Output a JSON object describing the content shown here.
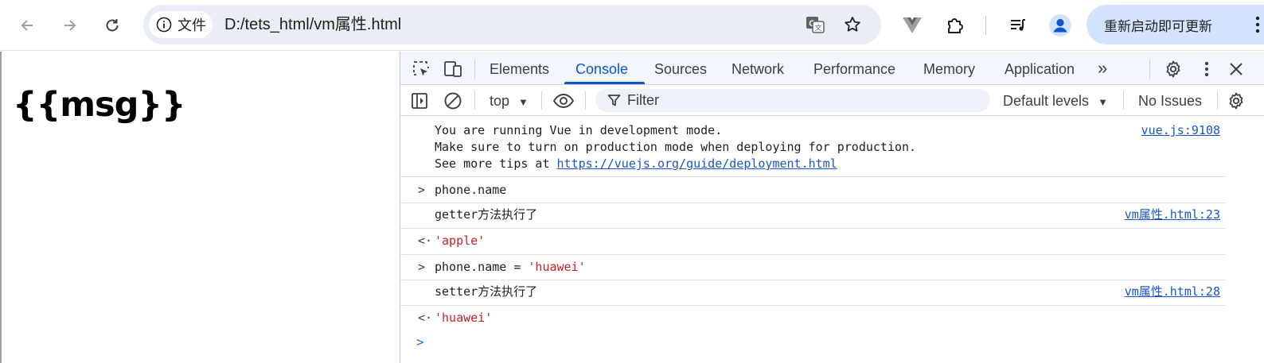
{
  "browser": {
    "nav": {
      "back_icon": "back-arrow-icon",
      "forward_icon": "forward-arrow-icon",
      "reload_icon": "reload-icon"
    },
    "omnibox": {
      "site_info_label": "文件",
      "url": "D:/tets_html/vm属性.html",
      "translate_icon": "translate-icon",
      "bookmark_icon": "star-icon"
    },
    "extensions": [
      "vue-devtools-icon",
      "puzzle-extensions-icon",
      "media-queue-icon",
      "profile-avatar-icon"
    ],
    "update_button_label": "重新启动即可更新"
  },
  "page": {
    "heading": "{{msg}}"
  },
  "devtools": {
    "tabs": [
      {
        "label": "Elements",
        "active": false
      },
      {
        "label": "Console",
        "active": true
      },
      {
        "label": "Sources",
        "active": false
      },
      {
        "label": "Network",
        "active": false
      },
      {
        "label": "Performance",
        "active": false
      },
      {
        "label": "Memory",
        "active": false
      },
      {
        "label": "Application",
        "active": false
      }
    ],
    "more_tabs": "»",
    "filterbar": {
      "context": "top",
      "filter_placeholder": "Filter",
      "levels": "Default levels",
      "issues": "No Issues"
    },
    "console": {
      "vue_notice": {
        "line1": "You are running Vue in development mode.",
        "line2": "Make sure to turn on production mode when deploying for production.",
        "line3_prefix": "See more tips at ",
        "line3_link": "https://vuejs.org/guide/deployment.html",
        "source": "vue.js:9108"
      },
      "input1": "phone.name",
      "log1": {
        "text": "getter方法执行了",
        "source": "vm属性.html:23"
      },
      "result1": "'apple'",
      "input2_prefix": "phone.name = ",
      "input2_string": "'huawei'",
      "log2": {
        "text": "setter方法执行了",
        "source": "vm属性.html:28"
      },
      "result2": "'huawei'",
      "input_marker": ">",
      "result_marker": "<·",
      "prompt": ">"
    }
  },
  "colors": {
    "accent": "#0b57d0",
    "update_button": "#d3e3fd",
    "omnibox": "#e9eef6",
    "string": "#c4222b",
    "link": "#1a55c9"
  }
}
